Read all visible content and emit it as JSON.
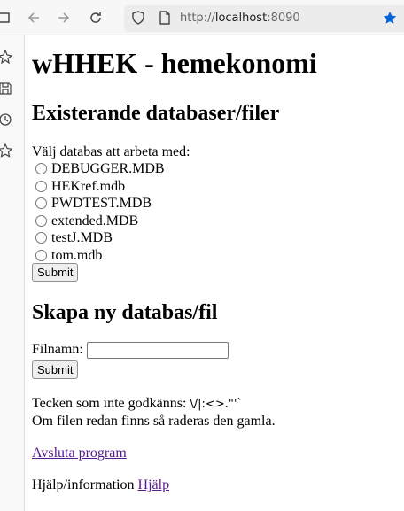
{
  "browser": {
    "url_prefix": "http://",
    "url_host": "localhost",
    "url_port": ":8090"
  },
  "page": {
    "title": "wHHEK - hemekonomi",
    "existing": {
      "heading": "Existerande databaser/filer",
      "prompt": "Välj databas att arbeta med:",
      "files": [
        "DEBUGGER.MDB",
        "HEKref.mdb",
        "PWDTEST.MDB",
        "extended.MDB",
        "testJ.MDB",
        "tom.mdb"
      ],
      "submit_label": "Submit"
    },
    "create": {
      "heading": "Skapa ny databas/fil",
      "filename_label": "Filnamn:",
      "filename_value": "",
      "submit_label": "Submit"
    },
    "notes": {
      "forbidden_prefix": "Tecken som inte godkänns: ",
      "forbidden_chars": "\\/|:<>.\"'`",
      "overwrite_note": "Om filen redan finns så raderas den gamla."
    },
    "exit_link": "Avsluta program",
    "help_prefix": "Hjälp/information ",
    "help_link": "Hjälp"
  },
  "colors": {
    "link": "#551a8b",
    "star": "#0a64d8"
  },
  "icons": [
    "back-arrow-icon",
    "forward-arrow-icon",
    "reload-icon",
    "shield-icon",
    "page-icon",
    "bookmark-star-icon",
    "sidebar-tabs-icon",
    "sidebar-pin-icon",
    "sidebar-save-icon",
    "history-icon",
    "favorites-star-icon"
  ]
}
